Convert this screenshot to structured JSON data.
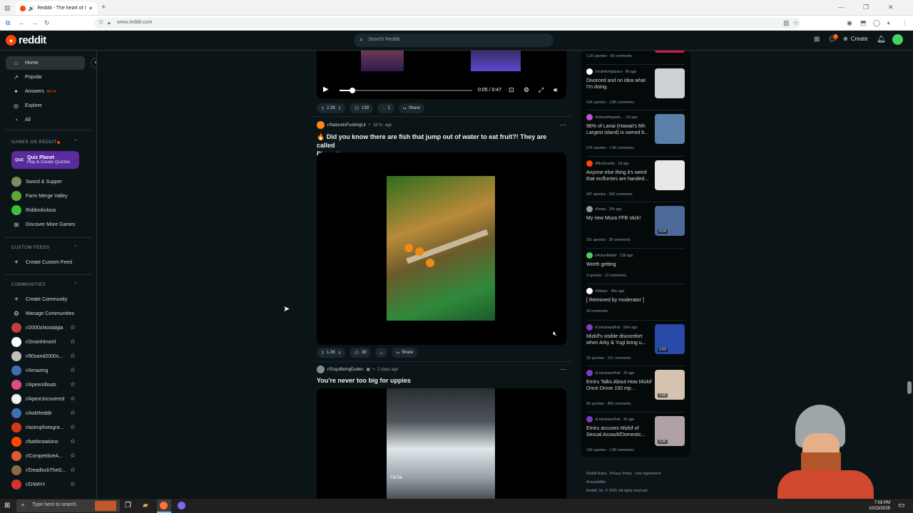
{
  "browser": {
    "tab_title": "Reddit - The heart of the in",
    "url": "www.reddit.com"
  },
  "header": {
    "logo_text": "reddit",
    "search_placeholder": "Search Reddit",
    "create_label": "Create"
  },
  "sidebar": {
    "nav": [
      {
        "label": "Home",
        "icon": "home-icon"
      },
      {
        "label": "Popular",
        "icon": "popular-icon"
      },
      {
        "label": "Answers",
        "icon": "answers-icon",
        "badge": "BETA"
      },
      {
        "label": "Explore",
        "icon": "explore-icon"
      },
      {
        "label": "All",
        "icon": "all-icon"
      }
    ],
    "games_header": "GAMES ON REDDIT",
    "quiz": {
      "title": "Quiz Planet",
      "subtitle": "Play & Create Quizzes",
      "icon_text": "QUIZ"
    },
    "games": [
      "Sword & Supper",
      "Farm Merge Valley",
      "Riddonkulous",
      "Discover More Games"
    ],
    "custom_feeds_header": "CUSTOM FEEDS",
    "create_custom_feed": "Create Custom Feed",
    "communities_header": "COMMUNITIES",
    "create_community": "Create Community",
    "manage_communities": "Manage Communities",
    "communities": [
      "r/2000sNostalgia",
      "r/2meirl4meirl",
      "r/90sand2000s...",
      "r/Amazing",
      "r/Apexrollouts",
      "r/ApexUncovered",
      "r/AskReddit",
      "r/astrophotogra...",
      "r/battlestations",
      "r/CompetitiveA...",
      "r/DeadlockTheG...",
      "r/DIWHY"
    ]
  },
  "feed": {
    "video_controls": {
      "time": "0:05 / 0:47"
    },
    "post1_actions": {
      "votes": "2.3K",
      "comments": "139",
      "awards": "1",
      "share": "Share"
    },
    "post2": {
      "subreddit": "r/NatureIsFuckingLit",
      "age": "18 hr. ago",
      "title_line1": "🔥 Did you know there are fish that jump out of water to eat fruit?! They are called",
      "title_line2": "Piraputanga.",
      "votes": "1.3K",
      "comments": "38",
      "share": "Share"
    },
    "post3": {
      "subreddit": "r/GuysBeingDudes",
      "age": "2 days ago",
      "title": "You're never too big for uppies",
      "watermark": "TikTok"
    }
  },
  "rail": {
    "top_stats": "1.1K upvotes · 65 comments",
    "posts": [
      {
        "sub": "r/malelivingspace · 8h ago",
        "title": "Divorced and no idea what I'm doing.",
        "stats": "41K upvotes · 3.8K comments"
      },
      {
        "sub": "r/interestingasfu... · 2d ago",
        "title": "98% of Lanai (Hawaii's 6th Largest island) is owned b...",
        "stats": "27K upvotes · 1.6K comments"
      },
      {
        "sub": "r/McDonalds · 2d ago",
        "title": "Anyone else thing it's weird that mcflurries are handed...",
        "stats": "347 upvotes · 342 comments"
      },
      {
        "sub": "r/hotas · 20h ago",
        "title": "My new Moza FFB stick!",
        "stats": "261 upvotes · 38 comments",
        "duration": "0:14"
      },
      {
        "sub": "r/ActiveMatter · 13h ago",
        "title": "Worth getting",
        "stats": "3 upvotes · 12 comments"
      },
      {
        "sub": "r/Steam · 36m ago",
        "title": "[ Removed by moderator ]",
        "stats": "19 comments"
      },
      {
        "sub": "r/LivestreamFail · 56m ago",
        "title": "Mizkif's visible discomfort when Arky & Yugi bring u...",
        "stats": "1K upvotes · 121 comments",
        "duration": "2:03"
      },
      {
        "sub": "r/LivestreamFail · 2h ago",
        "title": "Emiru Talks About How Mizkif Once Drove 150 mp...",
        "stats": "5K upvotes · 405 comments",
        "duration": "1:00"
      },
      {
        "sub": "r/LivestreamFail · 3h ago",
        "title": "Emiru accuses Mizkif of Sexual Assault/Domestic...",
        "stats": "15K upvotes · 1.8K comments",
        "duration": "0:30"
      }
    ],
    "footer_links": [
      "Reddit Rules",
      "Privacy Policy",
      "User Agreement",
      "Accessibility"
    ],
    "copyright": "Reddit, Inc. © 2025. All rights reserved."
  },
  "taskbar": {
    "search_placeholder": "Type here to search",
    "time": "7:03 PM",
    "date": "10/23/2025"
  }
}
